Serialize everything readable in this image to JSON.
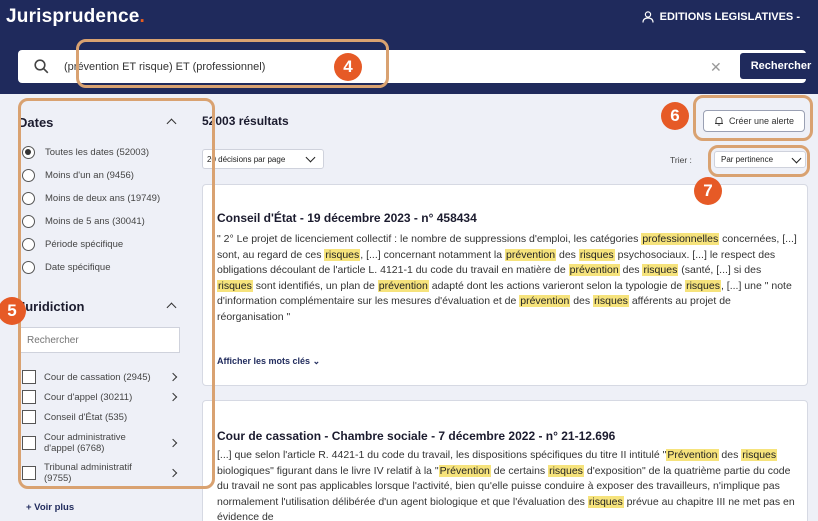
{
  "app": {
    "title": "Jurisprudence",
    "title_dot": ".",
    "account_label": "EDITIONS LEGISLATIVES -"
  },
  "search": {
    "query": "(prévention ET risque) ET (professionnel)",
    "button_label": "Rechercher"
  },
  "sidebar": {
    "dates_title": "Dates",
    "date_options": [
      {
        "label": "Toutes les dates (52003)",
        "selected": true
      },
      {
        "label": "Moins d'un an (9456)",
        "selected": false
      },
      {
        "label": "Moins de deux ans (19749)",
        "selected": false
      },
      {
        "label": "Moins de 5 ans (30041)",
        "selected": false
      },
      {
        "label": "Période spécifique",
        "selected": false
      },
      {
        "label": "Date spécifique",
        "selected": false
      }
    ],
    "juridiction_title": "Juridiction",
    "juridiction_search_placeholder": "Rechercher",
    "juridictions": [
      {
        "label": "Cour de cassation (2945)",
        "has_children": true
      },
      {
        "label": "Cour d'appel (30211)",
        "has_children": true
      },
      {
        "label": "Conseil d'État (535)",
        "has_children": false
      },
      {
        "label": "Cour administrative d'appel (6768)",
        "has_children": true
      },
      {
        "label": "Tribunal administratif (9755)",
        "has_children": true
      }
    ],
    "see_more": "+ Voir plus"
  },
  "results": {
    "count_label": "52003 résultats",
    "alert_button": "Créer une alerte",
    "per_page": "20 décisions par page",
    "sort_label": "Trier :",
    "sort_value": "Par pertinence"
  },
  "cards": [
    {
      "title": "Conseil d'État - 19 décembre 2023 - n° 458434",
      "segments": [
        {
          "t": "\" 2° Le projet de licenciement collectif : le nombre de suppressions d'emploi, les catégories "
        },
        {
          "t": "professionnelles",
          "hl": true
        },
        {
          "t": " concernées, [...] sont, au regard de ces "
        },
        {
          "t": "risques",
          "hl": true
        },
        {
          "t": ", [...] concernant notamment la "
        },
        {
          "t": "prévention",
          "hl": true
        },
        {
          "t": " des "
        },
        {
          "t": "risques",
          "hl": true
        },
        {
          "t": " psychosociaux. [...] le respect des obligations découlant de l'article L. 4121-1 du code du travail en matière de "
        },
        {
          "t": "prévention",
          "hl": true
        },
        {
          "t": " des "
        },
        {
          "t": "risques",
          "hl": true
        },
        {
          "t": " (santé, [...] si des "
        },
        {
          "t": "risques",
          "hl": true
        },
        {
          "t": " sont identifiés, un plan de "
        },
        {
          "t": "prévention",
          "hl": true
        },
        {
          "t": " adapté dont les actions varieront selon la typologie de "
        },
        {
          "t": "risques",
          "hl": true
        },
        {
          "t": ", [...] une \" note d'information complémentaire sur les mesures d'évaluation et de "
        },
        {
          "t": "prévention",
          "hl": true
        },
        {
          "t": " des "
        },
        {
          "t": "risques",
          "hl": true
        },
        {
          "t": " afférents au projet de réorganisation \""
        }
      ],
      "keywords_link": "Afficher les mots clés"
    },
    {
      "title": "Cour de cassation - Chambre sociale - 7 décembre 2022 - n° 21-12.696",
      "segments": [
        {
          "t": "[...] que selon l'article R. 4421-1 du code du travail, les dispositions spécifiques du titre II intitulé \""
        },
        {
          "t": "Prévention",
          "hl": true
        },
        {
          "t": " des "
        },
        {
          "t": "risques",
          "hl": true
        },
        {
          "t": " biologiques\" figurant dans le livre IV relatif à la \""
        },
        {
          "t": "Prévention",
          "hl": true
        },
        {
          "t": " de certains "
        },
        {
          "t": "risques",
          "hl": true
        },
        {
          "t": " d'exposition\" de la quatrième partie du code du travail ne sont pas applicables lorsque l'activité, bien qu'elle puisse conduire à exposer des travailleurs, n'implique pas normalement l'utilisation délibérée d'un agent biologique et que l'évaluation des "
        },
        {
          "t": "risques",
          "hl": true
        },
        {
          "t": " prévue au chapitre III ne met pas en évidence de"
        }
      ]
    }
  ],
  "annotations": [
    "4",
    "5",
    "6",
    "7"
  ],
  "colors": {
    "navy": "#1f2a5c",
    "highlight": "#f6e37c",
    "callout_orange": "#e65a26",
    "callout_border": "#d9a271"
  }
}
